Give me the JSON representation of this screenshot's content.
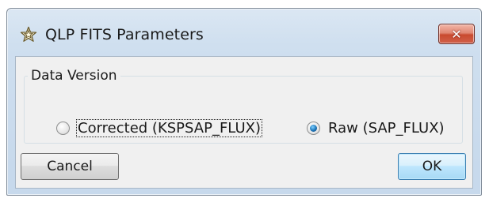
{
  "window": {
    "title": "QLP FITS Parameters",
    "close_label": "✕"
  },
  "group": {
    "label": "Data Version",
    "options": [
      {
        "label": "Corrected (KSPSAP_FLUX)",
        "selected": false
      },
      {
        "label": "Raw (SAP_FLUX)",
        "selected": true
      }
    ]
  },
  "buttons": {
    "cancel_label": "Cancel",
    "ok_label": "OK"
  },
  "icons": {
    "app": "star-outline-icon",
    "close": "close-icon"
  },
  "colors": {
    "accent": "#1d75b8",
    "close_button": "#c94a2f"
  }
}
